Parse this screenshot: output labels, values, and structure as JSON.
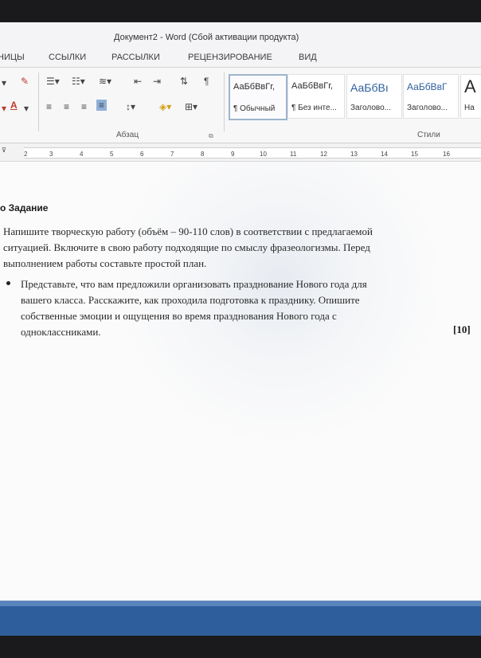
{
  "title": "Документ2 - Word (Сбой активации продукта)",
  "tabs": [
    "НИЦЫ",
    "ССЫЛКИ",
    "РАССЫЛКИ",
    "РЕЦЕНЗИРОВАНИЕ",
    "ВИД"
  ],
  "groups": {
    "paragraph": "Абзац",
    "styles": "Стили"
  },
  "styles": [
    {
      "preview": "АаБбВвГг,",
      "name": "¶ Обычный"
    },
    {
      "preview": "АаБбВвГг,",
      "name": "¶ Без инте..."
    },
    {
      "preview": "АаБбВı",
      "name": "Заголово..."
    },
    {
      "preview": "АаБбВвГ",
      "name": "Заголово..."
    },
    {
      "preview": "А",
      "name": "На"
    }
  ],
  "ruler_numbers": [
    "2",
    "3",
    "4",
    "5",
    "6",
    "7",
    "8",
    "9",
    "10",
    "11",
    "12",
    "13",
    "14",
    "15",
    "16"
  ],
  "document": {
    "heading": "о Задание",
    "intro": [
      "Напишите творческую работу (объём – 90-110 слов) в соответствии с предлагаемой",
      "ситуацией. Включите в свою работу подходящие по смыслу фразеологизмы. Перед",
      "выполнением работы составьте простой план."
    ],
    "bullet": [
      "Представьте, что вам предложили организовать празднование Нового года для",
      "вашего класса. Расскажите, как проходила подготовка к празднику. Опишите",
      "собственные эмоции и ощущения во время празднования Нового года с",
      "одноклассниками."
    ],
    "score": "[10]"
  }
}
